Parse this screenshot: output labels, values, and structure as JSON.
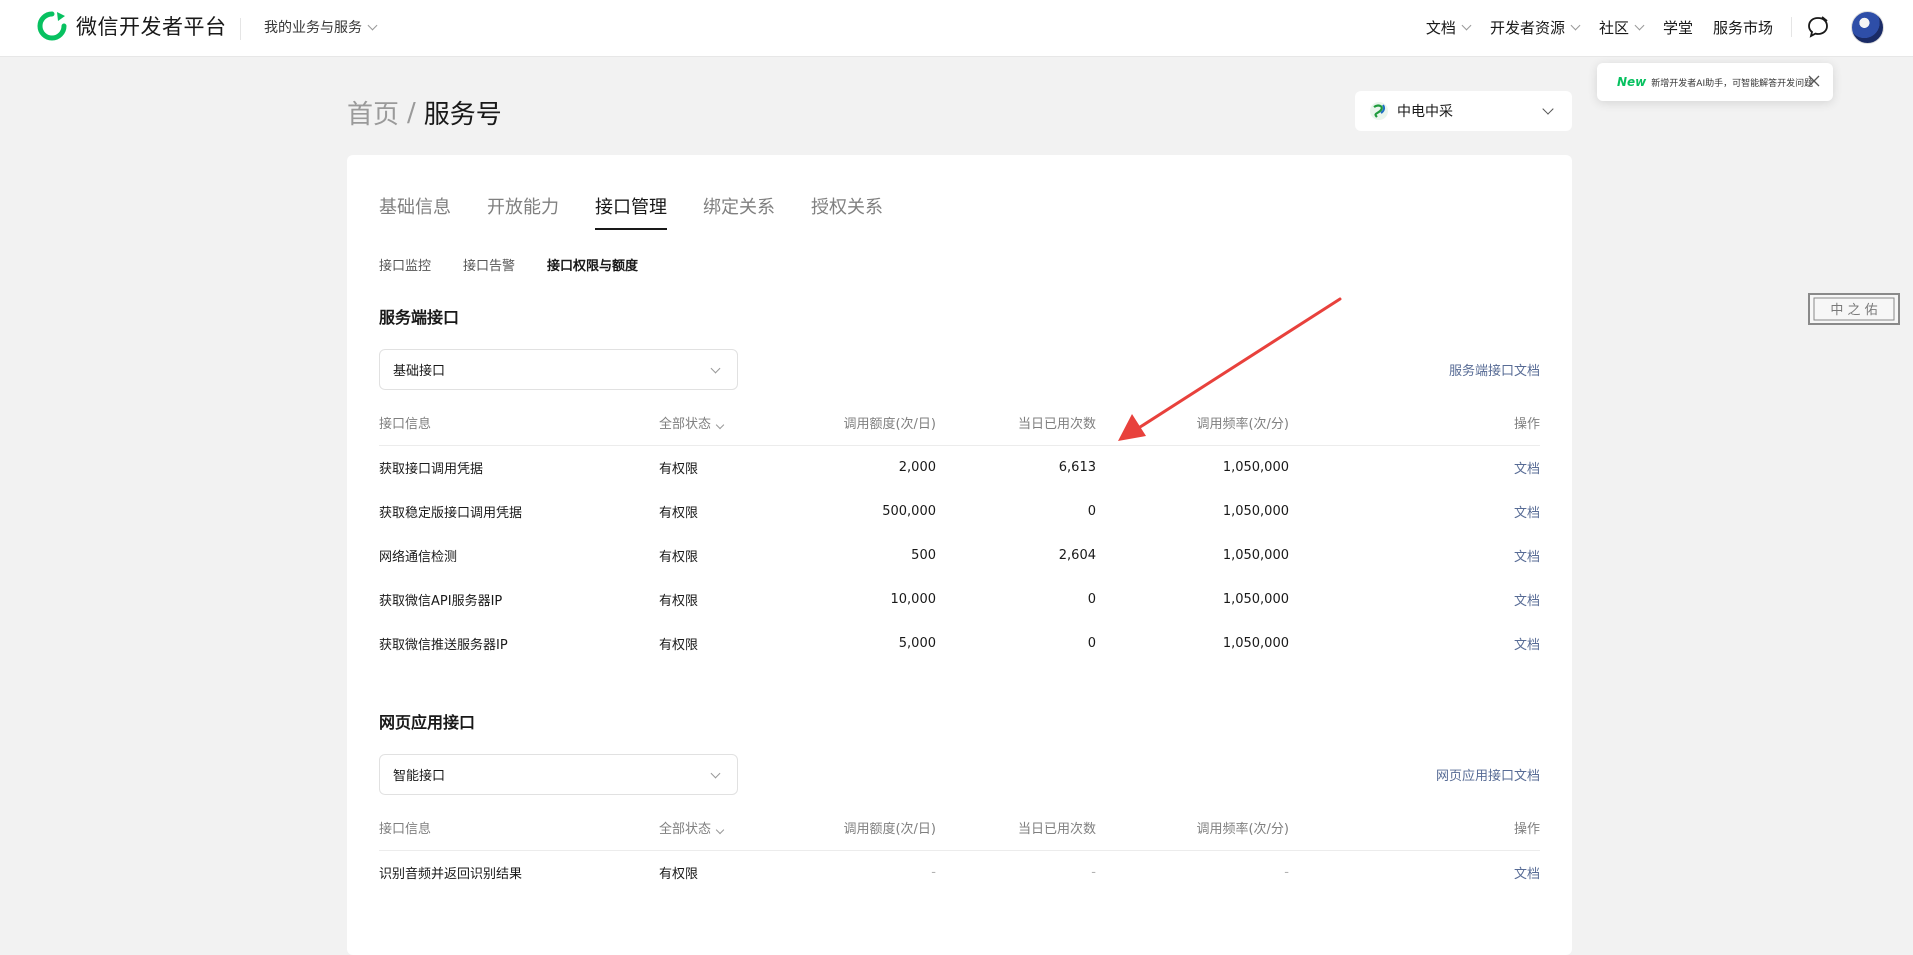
{
  "header": {
    "app_title": "微信开发者平台",
    "biz_menu": "我的业务与服务",
    "nav": [
      {
        "label": "文档",
        "has_dropdown": true
      },
      {
        "label": "开发者资源",
        "has_dropdown": true
      },
      {
        "label": "社区",
        "has_dropdown": true
      },
      {
        "label": "学堂",
        "has_dropdown": false
      },
      {
        "label": "服务市场",
        "has_dropdown": false
      }
    ],
    "message_icon": "chat-bubble-icon",
    "avatar_icon": "user-avatar"
  },
  "toast": {
    "badge": "New",
    "text": "新增开发者AI助手，可智能解答开发问题",
    "close_icon": "close-icon"
  },
  "breadcrumb": {
    "home": "首页",
    "separator": "/",
    "current": "服务号"
  },
  "account": {
    "name": "中电中采"
  },
  "tabs": [
    {
      "label": "基础信息",
      "active": false
    },
    {
      "label": "开放能力",
      "active": false
    },
    {
      "label": "接口管理",
      "active": true
    },
    {
      "label": "绑定关系",
      "active": false
    },
    {
      "label": "授权关系",
      "active": false
    }
  ],
  "subtabs": [
    {
      "label": "接口监控",
      "active": false
    },
    {
      "label": "接口告警",
      "active": false
    },
    {
      "label": "接口权限与额度",
      "active": true
    }
  ],
  "server_section": {
    "title": "服务端接口",
    "select_value": "基础接口",
    "doc_link": "服务端接口文档",
    "columns": [
      "接口信息",
      "全部状态",
      "调用额度(次/日)",
      "当日已用次数",
      "调用频率(次/分)",
      "操作"
    ],
    "rows": [
      {
        "name": "获取接口调用凭据",
        "status": "有权限",
        "quota": "2,000",
        "used": "6,613",
        "freq": "1,050,000",
        "action": "文档"
      },
      {
        "name": "获取稳定版接口调用凭据",
        "status": "有权限",
        "quota": "500,000",
        "used": "0",
        "freq": "1,050,000",
        "action": "文档"
      },
      {
        "name": "网络通信检测",
        "status": "有权限",
        "quota": "500",
        "used": "2,604",
        "freq": "1,050,000",
        "action": "文档"
      },
      {
        "name": "获取微信API服务器IP",
        "status": "有权限",
        "quota": "10,000",
        "used": "0",
        "freq": "1,050,000",
        "action": "文档"
      },
      {
        "name": "获取微信推送服务器IP",
        "status": "有权限",
        "quota": "5,000",
        "used": "0",
        "freq": "1,050,000",
        "action": "文档"
      }
    ]
  },
  "web_section": {
    "title": "网页应用接口",
    "select_value": "智能接口",
    "doc_link": "网页应用接口文档",
    "columns": [
      "接口信息",
      "全部状态",
      "调用额度(次/日)",
      "当日已用次数",
      "调用频率(次/分)",
      "操作"
    ],
    "rows": [
      {
        "name": "识别音频并返回识别结果",
        "status": "有权限",
        "quota": "-",
        "used": "-",
        "freq": "-",
        "action": "文档"
      }
    ]
  },
  "colors": {
    "brand_green": "#07c160",
    "link_blue": "#576b95",
    "annotation_arrow": "#e8413c"
  },
  "watermark_seal": "中 之 佑"
}
